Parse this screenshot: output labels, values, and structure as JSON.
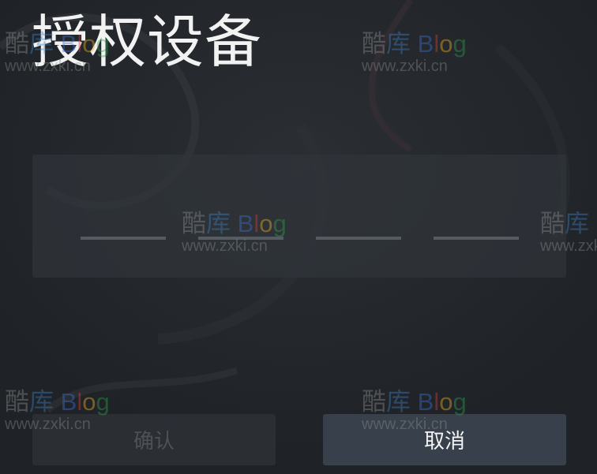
{
  "dialog": {
    "title": "授权设备",
    "code_slots": [
      "",
      "",
      "",
      ""
    ],
    "confirm_label": "确认",
    "cancel_label": "取消"
  },
  "watermark": {
    "site_cn_1": "酷",
    "site_cn_2": "库",
    "blog_b": "B",
    "blog_l": "l",
    "blog_o": "o",
    "blog_g": "g",
    "url": "www.zxki.cn"
  },
  "colors": {
    "background": "#23272b",
    "panel": "#30353a",
    "slot_line": "#555b61",
    "cancel_button": "#38414b",
    "confirm_button": "#34393e",
    "confirm_text_disabled": "#4c5257",
    "title_text": "#f2f2f2"
  }
}
